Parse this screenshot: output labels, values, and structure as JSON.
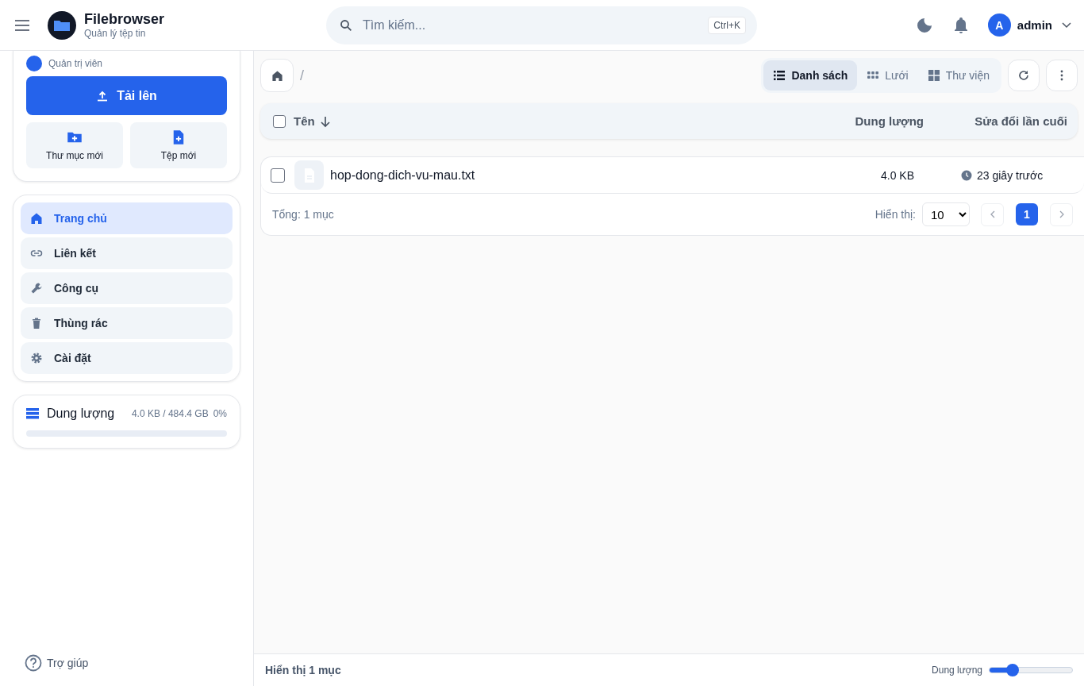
{
  "header": {
    "app_name": "Filebrowser",
    "app_subtitle": "Quản lý tệp tin",
    "search": {
      "placeholder": "Tìm kiếm...",
      "shortcut": "Ctrl+K"
    },
    "user": {
      "initial": "A",
      "name": "admin"
    }
  },
  "sidebar": {
    "profile": {
      "role": "Quản trị viên"
    },
    "upload_button": "Tải lên",
    "create_buttons": [
      {
        "kind": "folder",
        "label": "Thư mục mới"
      },
      {
        "kind": "file",
        "label": "Tệp mới"
      }
    ],
    "nav_items": [
      {
        "kind": "home",
        "label": "Trang chủ",
        "selected": true
      },
      {
        "kind": "link",
        "label": "Liên kết",
        "selected": false
      },
      {
        "kind": "tools",
        "label": "Công cụ",
        "selected": false
      },
      {
        "kind": "trash",
        "label": "Thùng rác",
        "selected": false
      },
      {
        "kind": "settings",
        "label": "Cài đặt",
        "selected": false
      }
    ],
    "storage": {
      "label": "Dung lượng",
      "usage": "4.0 KB / 484.4 GB",
      "percent": "0%",
      "level": 0.0
    },
    "help": "Trợ giúp"
  },
  "toolbar": {
    "breadcrumb_separator": "/",
    "views": [
      {
        "kind": "list",
        "label": "Danh sách",
        "selected": true
      },
      {
        "kind": "grid",
        "label": "Lưới",
        "selected": false
      },
      {
        "kind": "gallery",
        "label": "Thư viện",
        "selected": false
      }
    ]
  },
  "table": {
    "select_all_checked": false,
    "columns": [
      {
        "label": "Tên",
        "sorted": true
      },
      {
        "label": "Dung lượng",
        "sorted": false
      },
      {
        "label": "Sửa đổi lần cuối",
        "sorted": false
      }
    ],
    "rows": [
      {
        "name": "hop-dong-dich-vu-mau.txt",
        "size": "4.0 KB",
        "modified": "23 giây trước",
        "checked": false
      }
    ],
    "total": "Tổng: 1 mục",
    "page_size_label": "Hiển thị:",
    "page_size": "10",
    "pages": [
      {
        "label": "1",
        "selected": true
      }
    ]
  },
  "status_bar": {
    "text": "Hiển thị 1 mục",
    "slider_label": "Dung lượng",
    "slider": {
      "level": 0.28
    }
  }
}
